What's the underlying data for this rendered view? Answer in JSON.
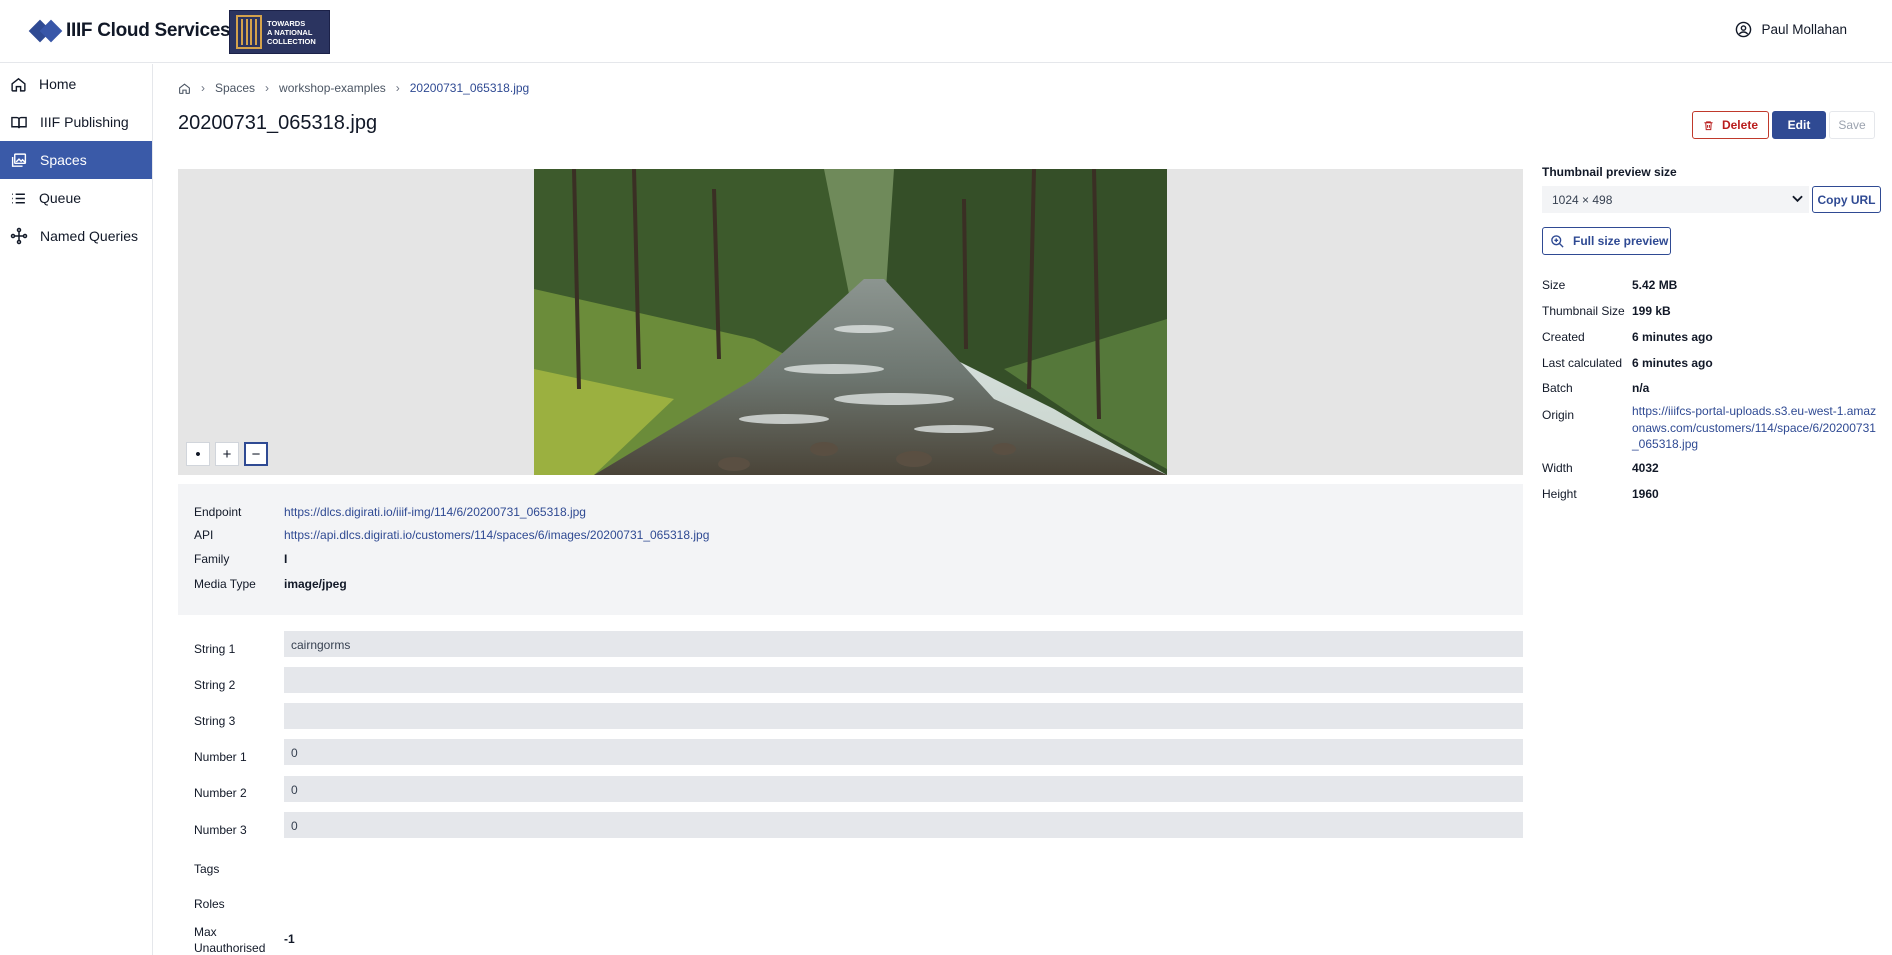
{
  "header": {
    "brand": "IIIF Cloud Services",
    "partner_logo": "TOWARDS A NATIONAL COLLECTION",
    "partner_logo_lines": [
      "TOWARDS",
      "A NATIONAL",
      "COLLECTION"
    ],
    "user_name": "Paul Mollahan"
  },
  "sidebar": {
    "items": [
      {
        "label": "Home",
        "icon": "home-icon"
      },
      {
        "label": "IIIF Publishing",
        "icon": "book-icon"
      },
      {
        "label": "Spaces",
        "icon": "images-icon",
        "active": true
      },
      {
        "label": "Queue",
        "icon": "list-icon"
      },
      {
        "label": "Named Queries",
        "icon": "query-icon"
      }
    ]
  },
  "breadcrumb": {
    "items": [
      "Spaces",
      "workshop-examples",
      "20200731_065318.jpg"
    ]
  },
  "page": {
    "title": "20200731_065318.jpg"
  },
  "actions": {
    "delete": "Delete",
    "edit": "Edit",
    "save": "Save"
  },
  "viewer": {
    "zoom_home": "•",
    "zoom_in": "+",
    "zoom_out": "−"
  },
  "info": {
    "endpoint_label": "Endpoint",
    "endpoint": "https://dlcs.digirati.io/iiif-img/114/6/20200731_065318.jpg",
    "api_label": "API",
    "api": "https://api.dlcs.digirati.io/customers/114/spaces/6/images/20200731_065318.jpg",
    "family_label": "Family",
    "family": "I",
    "media_type_label": "Media Type",
    "media_type": "image/jpeg"
  },
  "fields": {
    "string1_label": "String 1",
    "string1": "cairngorms",
    "string2_label": "String 2",
    "string2": "",
    "string3_label": "String 3",
    "string3": "",
    "number1_label": "Number 1",
    "number1": "0",
    "number2_label": "Number 2",
    "number2": "0",
    "number3_label": "Number 3",
    "number3": "0",
    "tags_label": "Tags",
    "roles_label": "Roles",
    "max_unauth_label": "Max Unauthorised",
    "max_unauth": "-1"
  },
  "right": {
    "thumb_label": "Thumbnail preview size",
    "thumb_value": "1024 × 498",
    "copy_url": "Copy URL",
    "full_preview": "Full size preview",
    "size_label": "Size",
    "size": "5.42 MB",
    "thumb_size_label": "Thumbnail Size",
    "thumb_size": "199 kB",
    "created_label": "Created",
    "created": "6 minutes ago",
    "last_calc_label": "Last calculated",
    "last_calc": "6 minutes ago",
    "batch_label": "Batch",
    "batch": "n/a",
    "origin_label": "Origin",
    "origin": "https://iiifcs-portal-uploads.s3.eu-west-1.amazonaws.com/customers/114/space/6/20200731_065318.jpg",
    "width_label": "Width",
    "width": "4032",
    "height_label": "Height",
    "height": "1960"
  },
  "colors": {
    "primary": "#2f4a93",
    "active_nav": "#3a5aa8",
    "danger": "#b91c1c"
  }
}
